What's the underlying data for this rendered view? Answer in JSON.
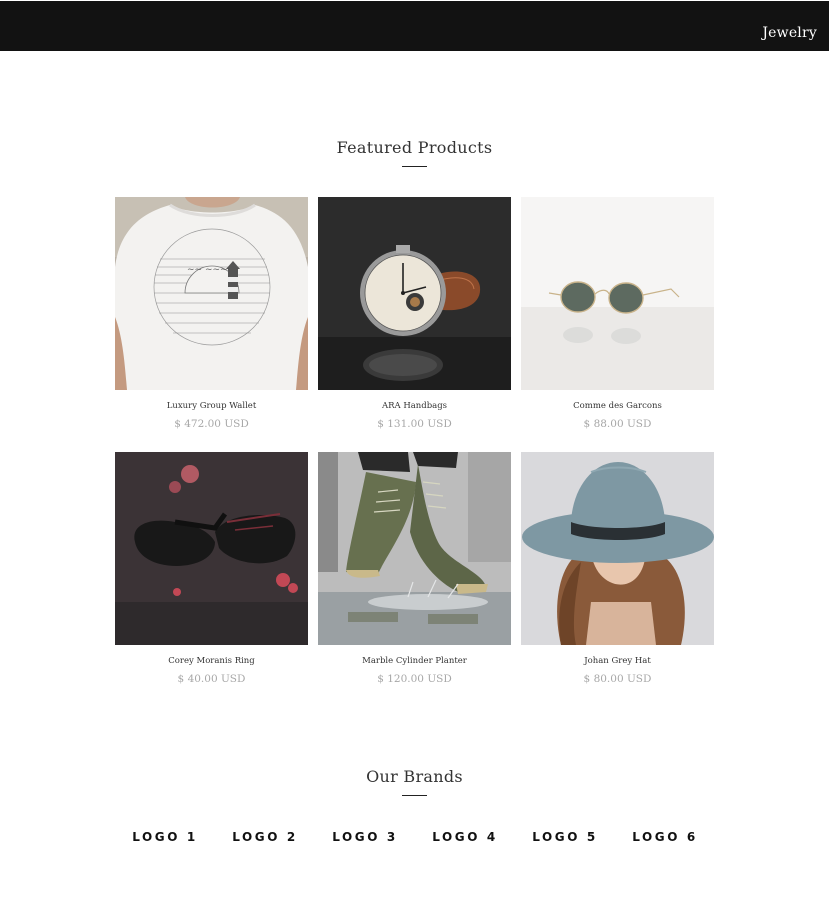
{
  "nav": {
    "link_label": "Jewelry"
  },
  "featured": {
    "title": "Featured Products",
    "products": [
      {
        "name": "Luxury Group Wallet",
        "price": "$ 472.00 USD",
        "image": "tshirt-back"
      },
      {
        "name": "ARA Handbags",
        "price": "$ 131.00 USD",
        "image": "wristwatch"
      },
      {
        "name": "Comme des Garcons",
        "price": "$ 88.00 USD",
        "image": "round-sunglasses"
      },
      {
        "name": "Corey Moranis Ring",
        "price": "$ 40.00 USD",
        "image": "dark-sunglasses"
      },
      {
        "name": "Marble Cylinder Planter",
        "price": "$ 120.00 USD",
        "image": "sneakers-splash"
      },
      {
        "name": "Johan Grey Hat",
        "price": "$ 80.00 USD",
        "image": "grey-fedora"
      }
    ]
  },
  "brands": {
    "title": "Our Brands",
    "logos": [
      "LOGO 1",
      "LOGO 2",
      "LOGO 3",
      "LOGO 4",
      "LOGO 5",
      "LOGO 6"
    ]
  }
}
